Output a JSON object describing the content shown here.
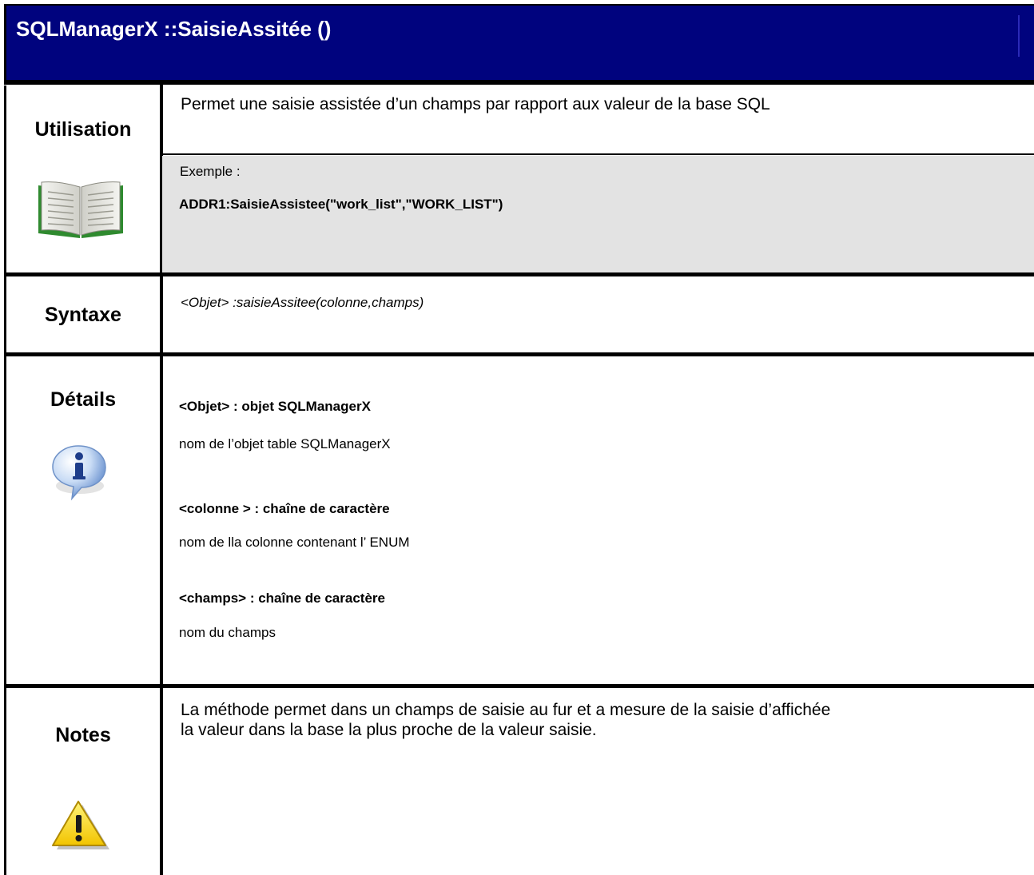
{
  "title": "SQLManagerX ::SaisieAssitée ()",
  "utilisation": {
    "label": "Utilisation",
    "description": "Permet une saisie assistée d’un champs par rapport aux valeur de la base SQL",
    "example_label": "Exemple :",
    "example_code": "ADDR1:SaisieAssistee(\"work_list\",\"WORK_LIST\")",
    "icon": "book-icon"
  },
  "syntaxe": {
    "label": "Syntaxe",
    "value": "<Objet> :saisieAssitee(colonne,champs)"
  },
  "details": {
    "label": "Détails",
    "icon": "info-icon",
    "params": [
      {
        "name": "<Objet> : objet SQLManagerX",
        "desc": "nom de l’objet table SQLManagerX"
      },
      {
        "name": "<colonne > : chaîne de caractère",
        "desc": "nom de lla colonne contenant l’ ENUM"
      },
      {
        "name": "<champs> : chaîne de caractère",
        "desc": "nom du champs"
      }
    ]
  },
  "notes": {
    "label": "Notes",
    "icon": "warning-icon",
    "line1": "La méthode permet dans un champs de saisie au fur et a mesure de la saisie d’affichée",
    "line2": "la valeur dans la base la plus proche de la valeur saisie."
  },
  "colors": {
    "title_bg": "#00037e",
    "example_bg": "#e3e3e3"
  }
}
